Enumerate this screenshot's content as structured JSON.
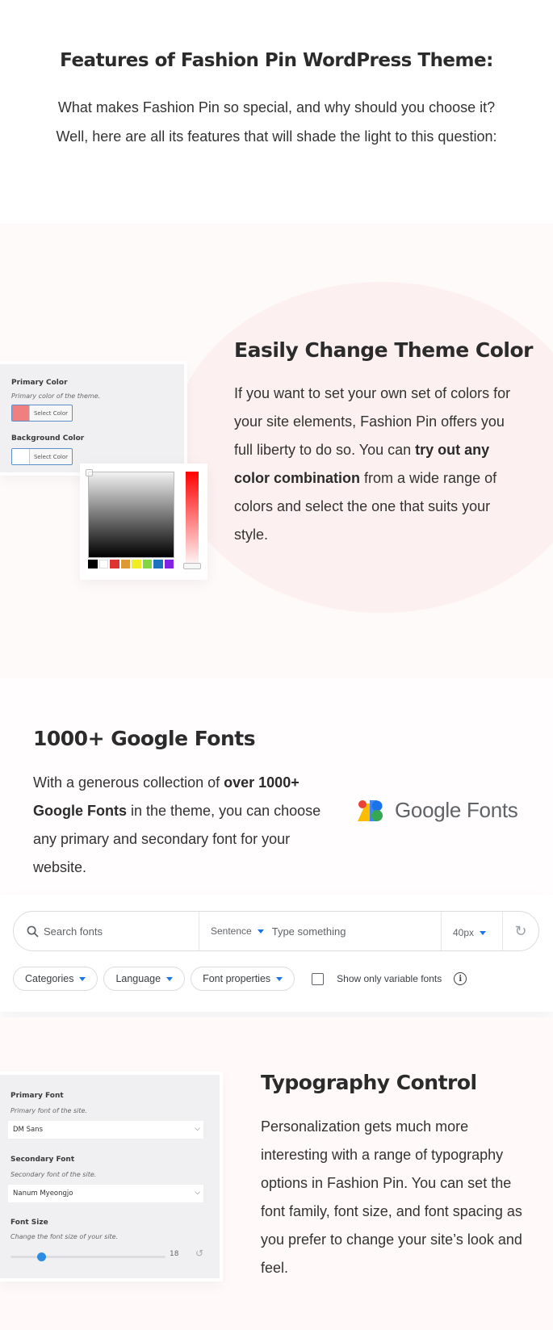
{
  "intro": {
    "title": "Features of Fashion Pin WordPress Theme:",
    "text": "What makes Fashion Pin so special, and why should you choose it? Well, here are all its features that will shade the light to this question:"
  },
  "color_section": {
    "title": "Easily Change Theme Color",
    "text_before": "If you want to set your own set of colors for your site elements, Fashion Pin offers you full liberty to do so. You can ",
    "text_bold": "try out any color combination",
    "text_after": " from a wide range of colors and select the one that suits your style.",
    "panel": {
      "primary_label": "Primary Color",
      "primary_desc": "Primary color of the theme.",
      "primary_swatch": "#f08080",
      "primary_button": "Select Color",
      "background_label": "Background Color",
      "background_swatch": "#ffffff",
      "background_button": "Select Color"
    },
    "picker": {
      "palette": [
        "#000000",
        "#ffffff",
        "#dd3333",
        "#dd9933",
        "#eeee22",
        "#81d742",
        "#1e73be",
        "#8224e3"
      ]
    }
  },
  "fonts_section": {
    "title": "1000+ Google Fonts",
    "text_before": "With a generous collection of ",
    "text_bold": "over 1000+ Google Fonts",
    "text_after": " in the theme, you can choose any primary and secondary font for your website.",
    "logo_text": "Google Fonts",
    "search": {
      "placeholder": "Search fonts",
      "sentence_label": "Sentence",
      "type_placeholder": "Type something",
      "size_label": "40px"
    },
    "filters": [
      "Categories",
      "Language",
      "Font properties"
    ],
    "variable_label": "Show only variable fonts",
    "variable_checked": false
  },
  "typography_section": {
    "title": "Typography Control",
    "text": "Personalization gets much more interesting with a range of typography options in Fashion Pin. You can set the font family, font size, and font spacing as you prefer to change your site’s look and feel.",
    "panel": {
      "primary_font_label": "Primary Font",
      "primary_font_desc": "Primary font of the site.",
      "primary_font_value": "DM Sans",
      "secondary_font_label": "Secondary Font",
      "secondary_font_desc": "Secondary font of the site.",
      "secondary_font_value": "Nanum Myeongjo",
      "font_size_label": "Font Size",
      "font_size_desc": "Change the font size of your site.",
      "font_size_value": "18",
      "font_size_fraction": 0.2
    }
  }
}
